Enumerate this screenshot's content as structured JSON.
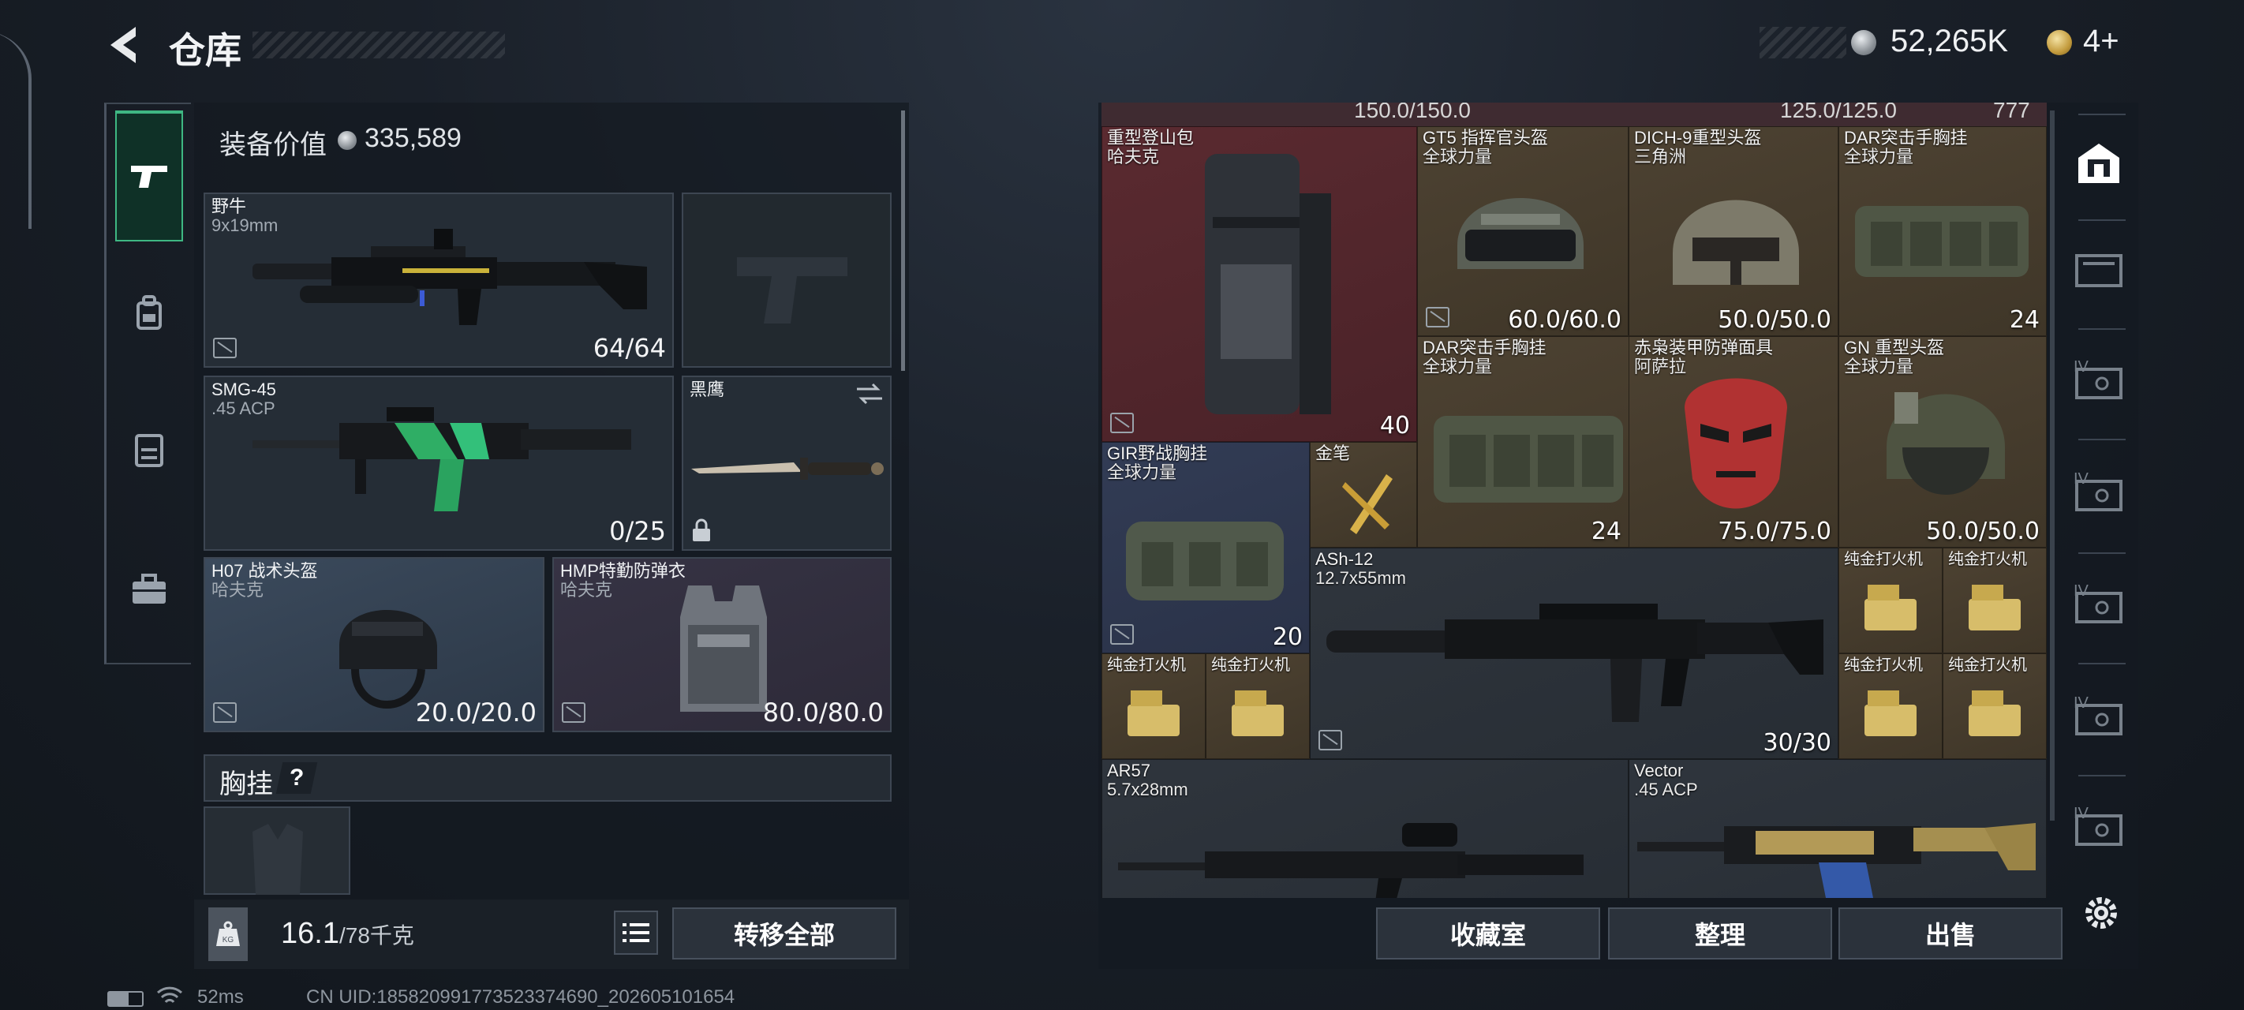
{
  "header": {
    "title": "仓库",
    "currency1": "52,265K",
    "currency2": "4+"
  },
  "left": {
    "equip_value_label": "装备价值",
    "equip_value": "335,589",
    "slots": {
      "primary": {
        "name": "野牛",
        "sub": "9x19mm",
        "val": "64/64"
      },
      "secondary": {
        "name": "SMG-45",
        "sub": ".45 ACP",
        "val": "0/25"
      },
      "melee": {
        "name": "黑鹰"
      },
      "helmet": {
        "name": "H07 战术头盔",
        "sub": "哈夫克",
        "val": "20.0/20.0"
      },
      "armor": {
        "name": "HMP特勤防弹衣",
        "sub": "哈夫克",
        "val": "80.0/80.0"
      }
    },
    "chest_rig_label": "胸挂",
    "chest_help": "?",
    "weight_value": "16.1",
    "weight_max": "/78千克",
    "kg_badge": "KG",
    "transfer_all": "转移全部"
  },
  "stash": {
    "top_values": [
      "150.0/150.0",
      "125.0/125.0",
      "777"
    ],
    "items": {
      "backpack": {
        "name": "重型登山包",
        "sub": "哈夫克",
        "val": "40"
      },
      "gt5": {
        "name": "GT5 指挥官头盔",
        "sub": "全球力量",
        "val": "60.0/60.0"
      },
      "dich": {
        "name": "DICH-9重型头盔",
        "sub": "三角洲",
        "val": "50.0/50.0"
      },
      "dar1": {
        "name": "DAR突击手胸挂",
        "sub": "全球力量",
        "val": "24"
      },
      "dar2": {
        "name": "DAR突击手胸挂",
        "sub": "全球力量",
        "val": "24"
      },
      "mask": {
        "name": "赤枭装甲防弹面具",
        "sub": "阿萨拉",
        "val": "75.0/75.0"
      },
      "gn": {
        "name": "GN 重型头盔",
        "sub": "全球力量",
        "val": "50.0/50.0"
      },
      "gir": {
        "name": "GIR野战胸挂",
        "sub": "全球力量",
        "val": "20"
      },
      "pen": {
        "name": "金笔"
      },
      "ash": {
        "name": "ASh-12",
        "sub": "12.7x55mm",
        "val": "30/30"
      },
      "lighter": {
        "name": "纯金打火机"
      },
      "ar57": {
        "name": "AR57",
        "sub": "5.7x28mm"
      },
      "vector": {
        "name": "Vector",
        "sub": ".45 ACP"
      }
    },
    "buttons": {
      "collection": "收藏室",
      "sort": "整理",
      "sell": "出售"
    }
  },
  "status": {
    "ping": "52ms",
    "uid": "CN UID:185820991773523374690_202605101654"
  },
  "right_tabs": {
    "level_label": "IV"
  },
  "colors": {
    "accent_green": "#3fb783",
    "slot_bg": "#252d36",
    "red_cell": "#5a2a30",
    "gold_cell": "#4d4232",
    "blue_cell": "#323c55"
  }
}
